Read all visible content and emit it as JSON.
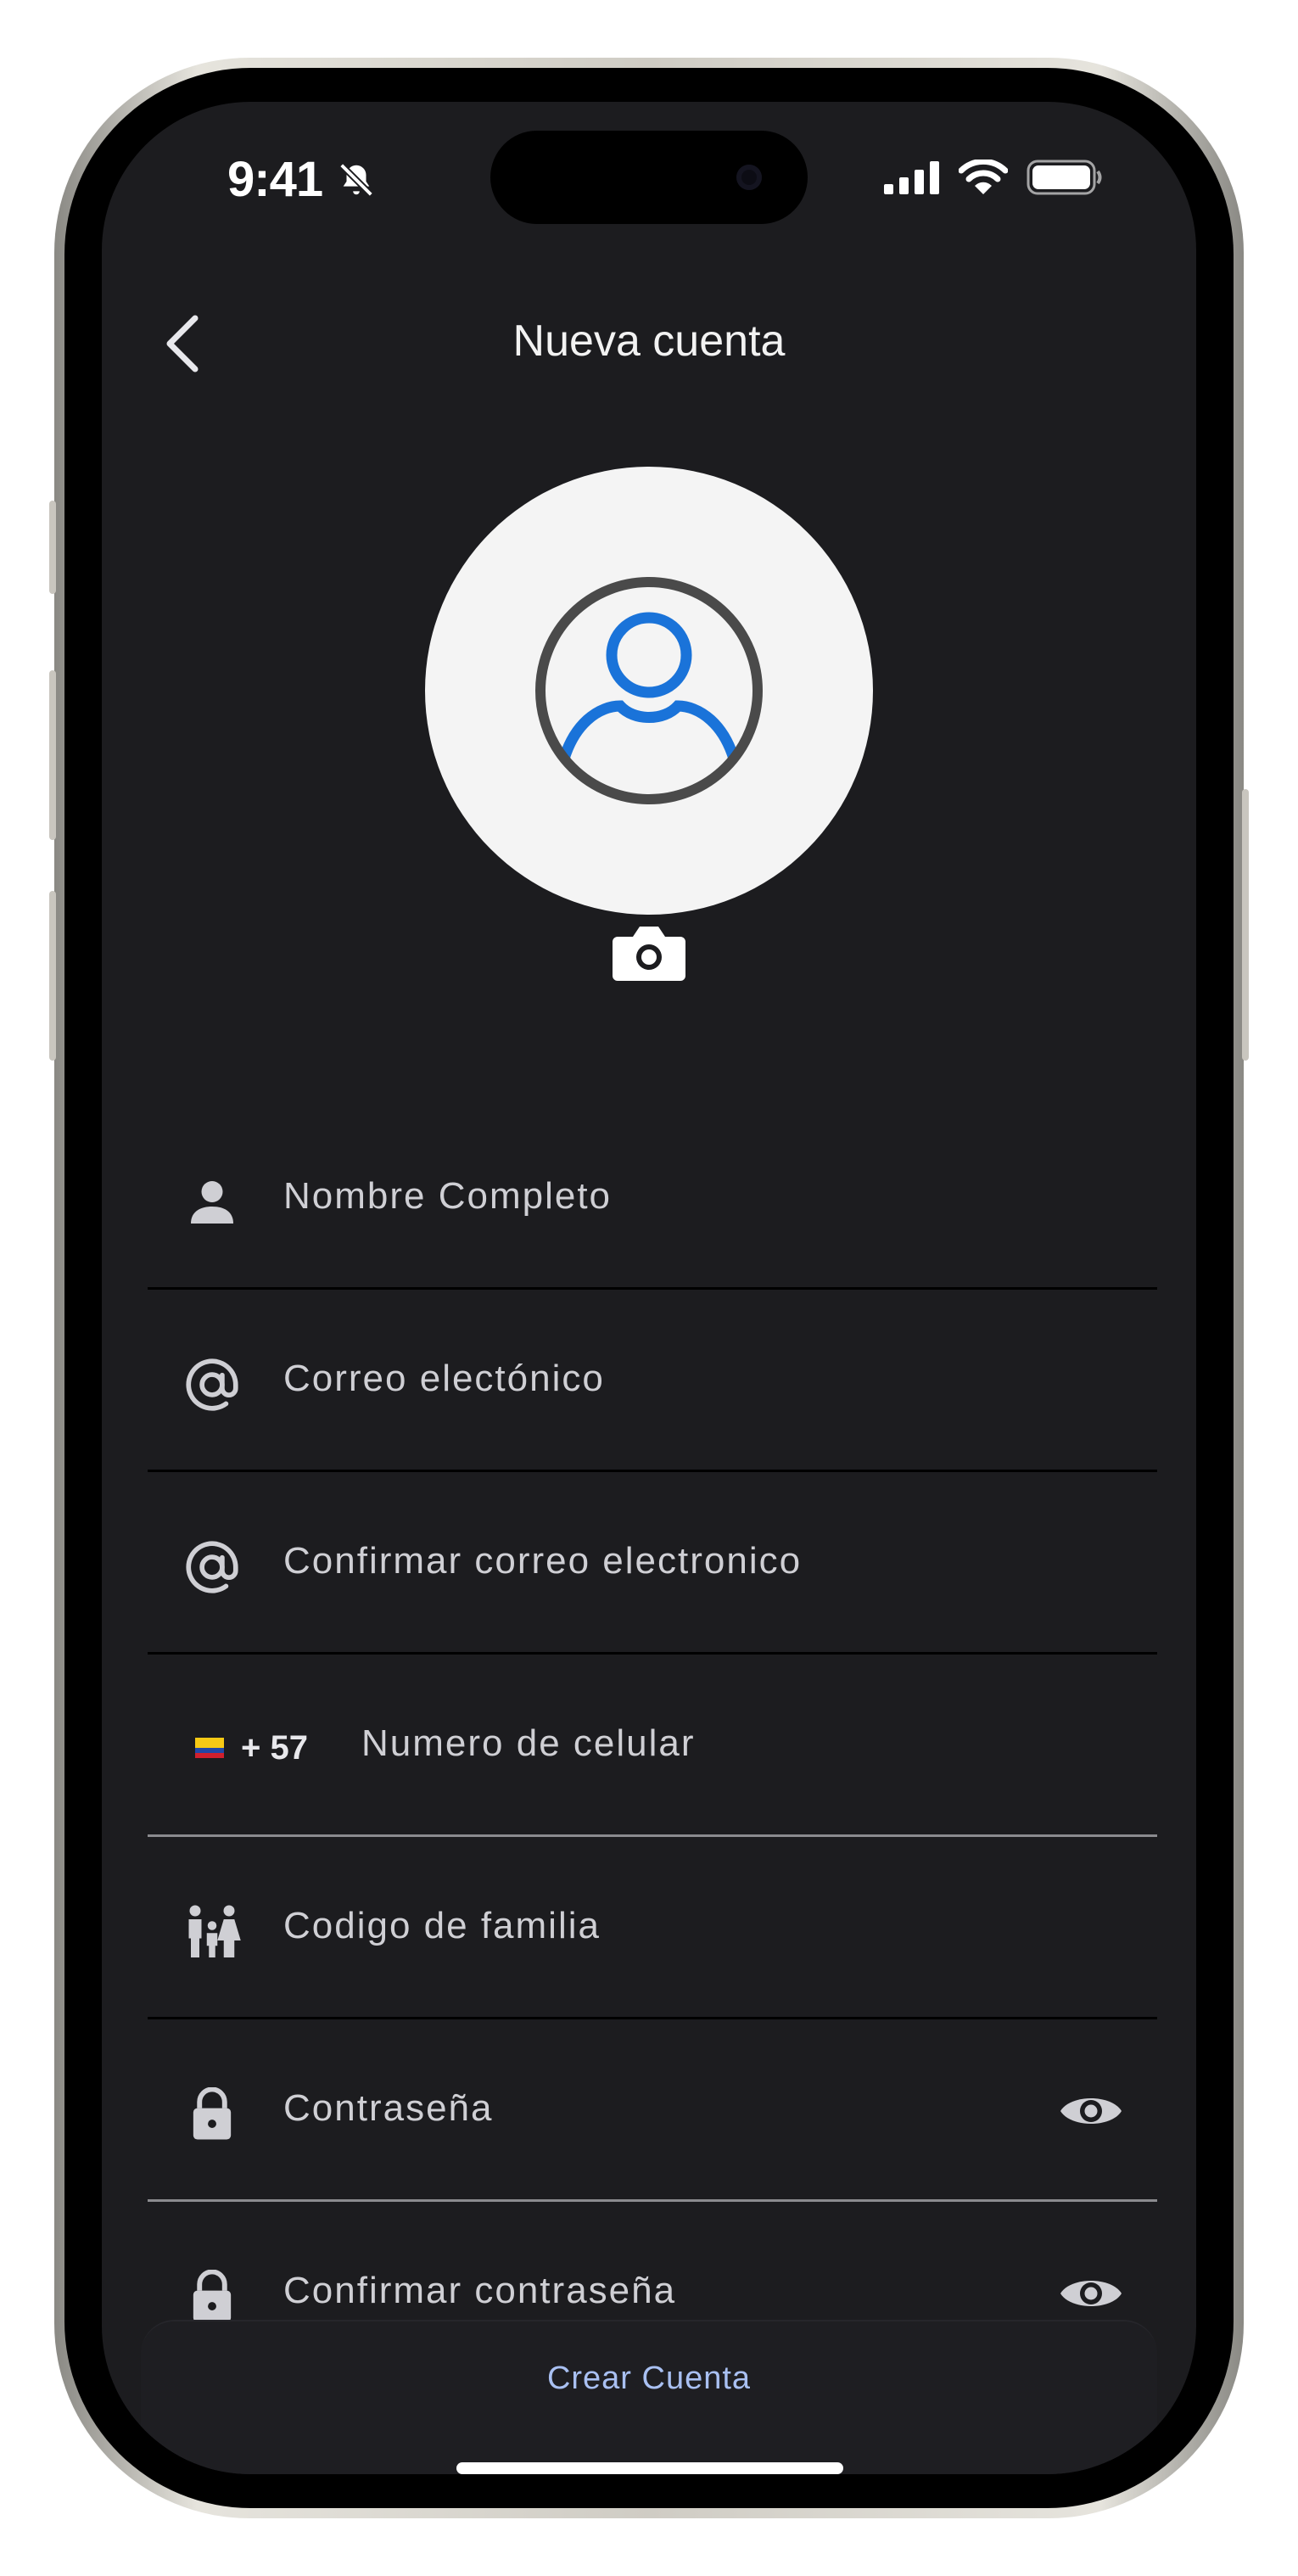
{
  "status_bar": {
    "time": "9:41"
  },
  "header": {
    "title": "Nueva cuenta"
  },
  "form": {
    "full_name_placeholder": "Nombre Completo",
    "email_placeholder": "Correo electónico",
    "confirm_email_placeholder": "Confirmar correo electronico",
    "phone_prefix": "+ 57",
    "phone_placeholder": "Numero de celular",
    "family_code_placeholder": "Codigo de familia",
    "password_placeholder": "Contraseña",
    "confirm_password_placeholder": "Confirmar contraseña"
  },
  "actions": {
    "create_account_label": "Crear Cuenta"
  },
  "colors": {
    "background": "#1c1c1f",
    "accent_link": "#a9c0f2",
    "avatar_blue": "#1a73d9"
  }
}
